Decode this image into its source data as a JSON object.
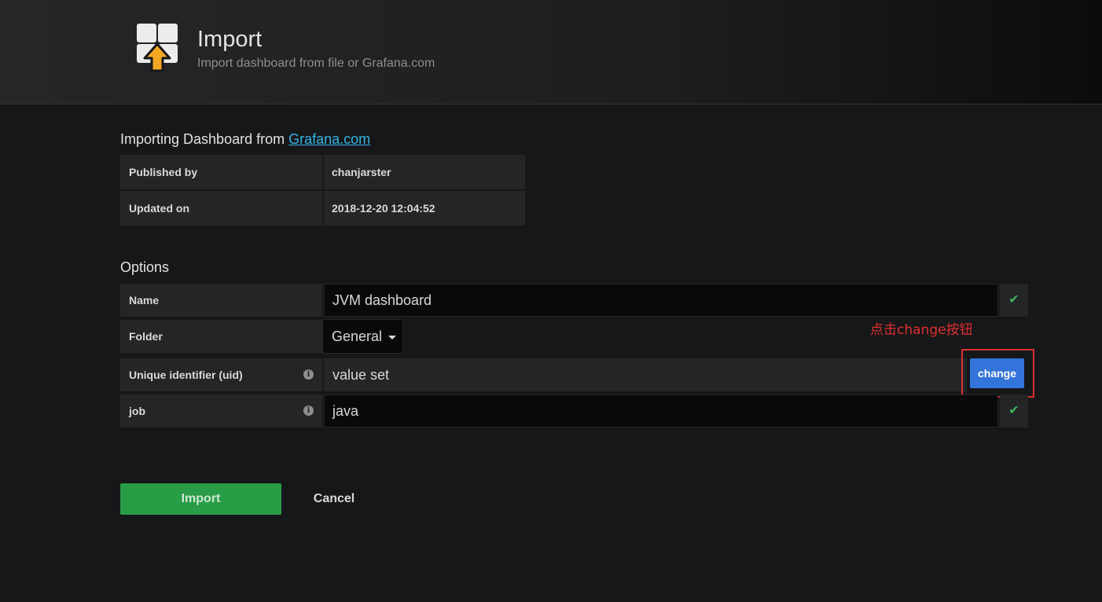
{
  "header": {
    "title": "Import",
    "subtitle": "Import dashboard from file or Grafana.com",
    "icon": "dashboard-import-icon"
  },
  "source": {
    "heading_prefix": "Importing Dashboard from ",
    "heading_link": "Grafana.com",
    "rows": [
      {
        "label": "Published by",
        "value": "chanjarster"
      },
      {
        "label": "Updated on",
        "value": "2018-12-20 12:04:52"
      }
    ]
  },
  "options": {
    "heading": "Options",
    "name": {
      "label": "Name",
      "value": "JVM dashboard"
    },
    "folder": {
      "label": "Folder",
      "value": "General"
    },
    "uid": {
      "label": "Unique identifier (uid)",
      "value": "value set",
      "button": "change"
    },
    "job": {
      "label": "job",
      "value": "java"
    }
  },
  "annotation": {
    "text": "点击change按钮",
    "color": "#e02f2f"
  },
  "actions": {
    "import_label": "Import",
    "cancel_label": "Cancel"
  },
  "colors": {
    "accent_blue": "#3274d9",
    "success_green": "#299c46",
    "link": "#33b5e5"
  }
}
